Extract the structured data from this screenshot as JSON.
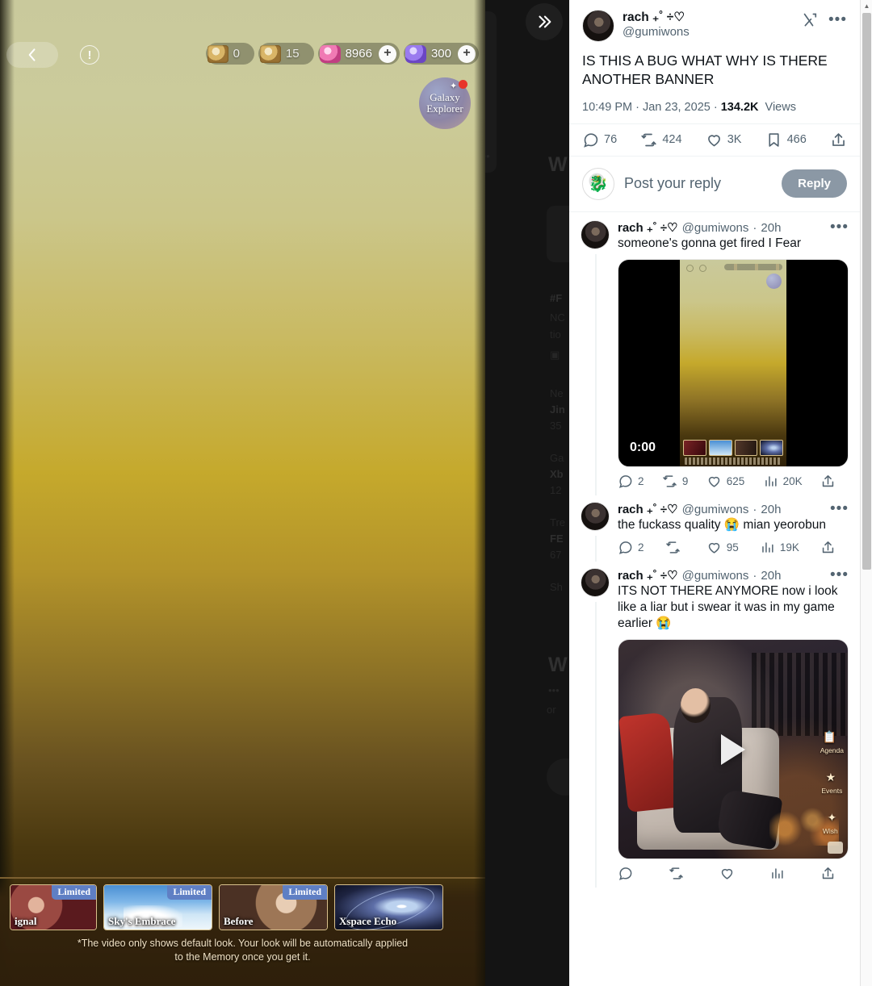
{
  "game": {
    "back_icon": "back-arrow-icon",
    "info_icon": "info-icon",
    "currencies": [
      {
        "icon": "gold-ticket-icon",
        "value": "0"
      },
      {
        "icon": "gold-ticket-icon",
        "value": "15"
      },
      {
        "icon": "pink-diamond-icon",
        "value": "8966",
        "plus": "+"
      },
      {
        "icon": "purple-crystal-icon",
        "value": "300",
        "plus": "+"
      }
    ],
    "galaxy_badge": {
      "line1": "Galaxy",
      "line2": "Explorer"
    },
    "cards": [
      {
        "name": "ignal",
        "tag": "Limited"
      },
      {
        "name": "Sky's Embrace",
        "tag": "Limited"
      },
      {
        "name": "Before",
        "tag": "Limited"
      },
      {
        "name": "Xspace Echo",
        "tag": ""
      }
    ],
    "note_line1": "*The video only shows default look. Your look will be automatically applied",
    "note_line2": "to the Memory once you get it."
  },
  "gutter": {
    "expand_icon": "chevron-double-right-icon"
  },
  "x": {
    "main_post": {
      "display_name": "rach ₊˚ ÷♡",
      "handle": "@gumiwons",
      "x_logo": "x-logo-icon",
      "more_icon": "more-options-icon",
      "text": "IS THIS A BUG WHAT WHY IS THERE ANOTHER BANNER",
      "time": "10:49 PM",
      "date": "Jan 23, 2025",
      "views_count": "134.2K",
      "views_label": "Views",
      "metrics": {
        "replies": "76",
        "reposts": "424",
        "likes": "3K",
        "bookmarks": "466",
        "share_icon": "share-icon"
      }
    },
    "reply_box": {
      "placeholder": "Post your reply",
      "button_label": "Reply",
      "avatar": "user-avatar-placeholder"
    },
    "replies": [
      {
        "display_name": "rach ₊˚ ÷♡",
        "handle": "@gumiwons",
        "time": "20h",
        "text": "someone's gonna get fired I Fear",
        "media": {
          "type": "video",
          "duration": "0:00"
        },
        "metrics": {
          "replies": "2",
          "reposts": "9",
          "likes": "625",
          "views": "20K",
          "share_icon": "share-icon"
        }
      },
      {
        "display_name": "rach ₊˚ ÷♡",
        "handle": "@gumiwons",
        "time": "20h",
        "text": "the fuckass quality 😭 mian yeorobun",
        "media": null,
        "metrics": {
          "replies": "2",
          "reposts": "",
          "likes": "95",
          "views": "19K",
          "share_icon": "share-icon"
        }
      },
      {
        "display_name": "rach ₊˚ ÷♡",
        "handle": "@gumiwons",
        "time": "20h",
        "text": "ITS NOT THERE ANYMORE now i look like a liar but i swear it was in my game earlier 😭",
        "media": {
          "type": "video",
          "side_labels": [
            "Agenda",
            "Events",
            "Wish"
          ]
        },
        "metrics": {
          "replies": "",
          "reposts": "",
          "likes": "",
          "views": "",
          "share_icon": "share-icon"
        }
      }
    ]
  },
  "scrollbar": {
    "up_arrow": "scroll-up-arrow-icon"
  },
  "colors": {
    "x_text": "#0f1419",
    "x_muted": "#536471",
    "reply_button_bg": "#8b98a5",
    "limited_badge": "#5f7fc4",
    "game_gradient_top": "#c9c99c",
    "game_gradient_mid": "#c5a92c",
    "game_gradient_bottom": "#2e2008"
  }
}
